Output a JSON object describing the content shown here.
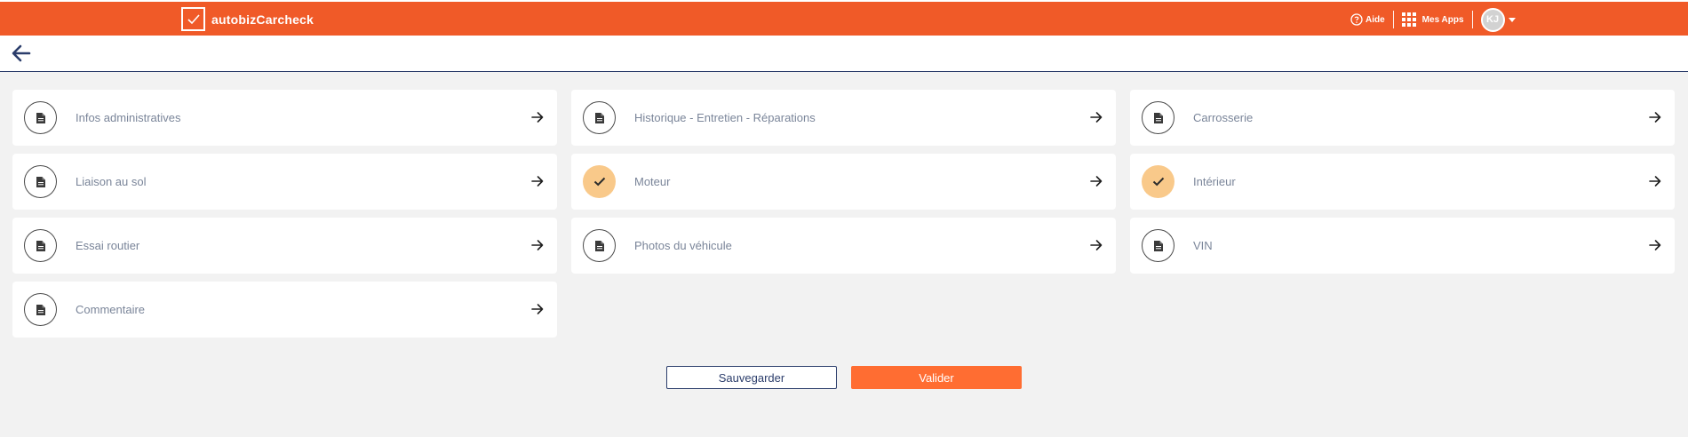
{
  "header": {
    "brand_name": "autobizCarcheck",
    "help_label": "Aide",
    "apps_label": "Mes Apps",
    "avatar_initials": "KJ"
  },
  "colors": {
    "header_bg": "#f05a28",
    "done_bg": "#f9c98a",
    "primary_button": "#ff6d32",
    "navy": "#2b3d6b"
  },
  "sections": [
    {
      "label": "Infos administratives",
      "done": false
    },
    {
      "label": "Historique - Entretien - Réparations",
      "done": false
    },
    {
      "label": "Carrosserie",
      "done": false
    },
    {
      "label": "Liaison au sol",
      "done": false
    },
    {
      "label": "Moteur",
      "done": true
    },
    {
      "label": "Intérieur",
      "done": true
    },
    {
      "label": "Essai routier",
      "done": false
    },
    {
      "label": "Photos du véhicule",
      "done": false
    },
    {
      "label": "VIN",
      "done": false
    },
    {
      "label": "Commentaire",
      "done": false
    }
  ],
  "actions": {
    "save_label": "Sauvegarder",
    "validate_label": "Valider"
  }
}
